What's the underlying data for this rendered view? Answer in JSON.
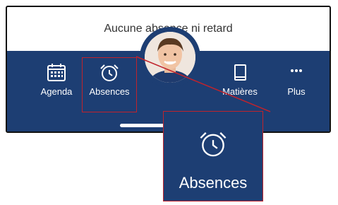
{
  "banner": {
    "text": "Aucune absence ni retard"
  },
  "tabs": [
    {
      "label": "Agenda",
      "icon": "calendar-icon"
    },
    {
      "label": "Absences",
      "icon": "alarm-clock-icon"
    },
    {
      "label": "Matières",
      "icon": "book-icon"
    },
    {
      "label": "Plus",
      "icon": "more-dots-icon"
    }
  ],
  "zoom": {
    "label": "Absences",
    "icon": "alarm-clock-icon"
  },
  "colors": {
    "tabbar": "#1d3e73",
    "highlight": "#c0232c",
    "text_light": "#ffffff"
  }
}
